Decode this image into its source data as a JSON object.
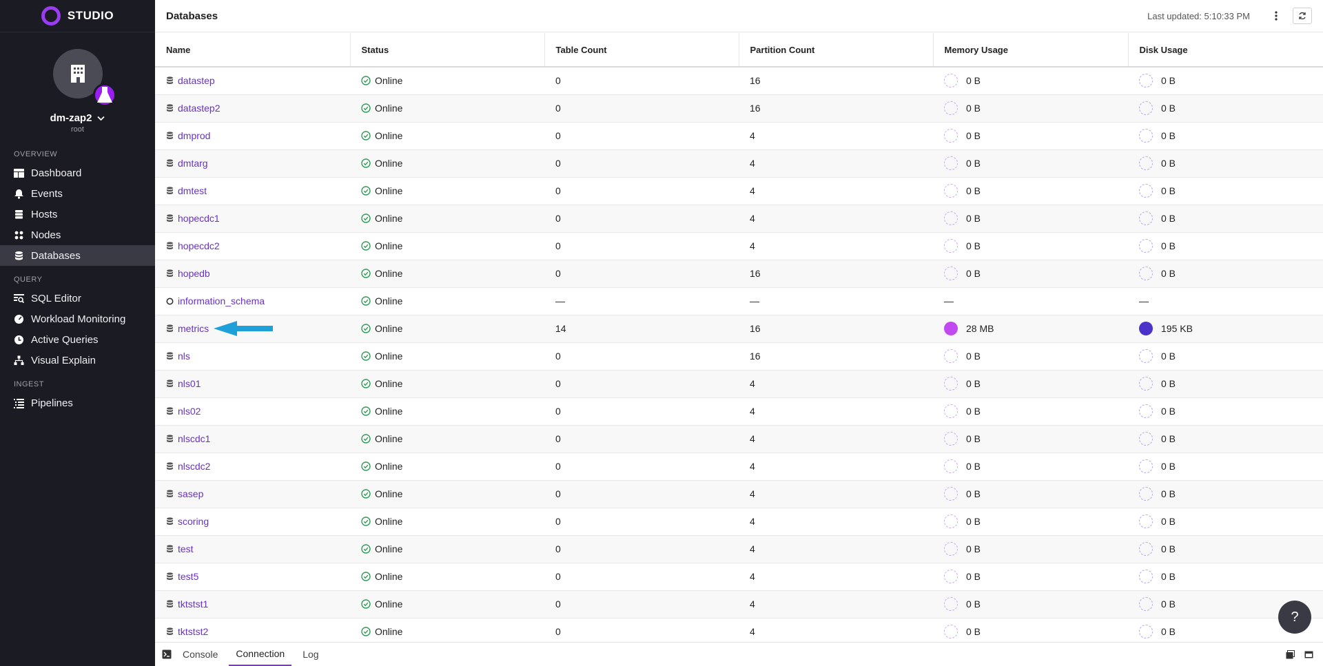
{
  "brand": {
    "name": "STUDIO"
  },
  "org": {
    "name": "dm-zap2",
    "role": "root"
  },
  "nav": {
    "overview_label": "OVERVIEW",
    "overview": [
      {
        "label": "Dashboard",
        "icon": "dashboard-icon"
      },
      {
        "label": "Events",
        "icon": "bell-icon"
      },
      {
        "label": "Hosts",
        "icon": "server-icon"
      },
      {
        "label": "Nodes",
        "icon": "nodes-icon"
      },
      {
        "label": "Databases",
        "icon": "database-icon",
        "active": true
      }
    ],
    "query_label": "QUERY",
    "query": [
      {
        "label": "SQL Editor",
        "icon": "sql-editor-icon"
      },
      {
        "label": "Workload Monitoring",
        "icon": "gauge-icon"
      },
      {
        "label": "Active Queries",
        "icon": "clock-icon"
      },
      {
        "label": "Visual Explain",
        "icon": "tree-icon"
      }
    ],
    "ingest_label": "INGEST",
    "ingest": [
      {
        "label": "Pipelines",
        "icon": "pipelines-icon"
      }
    ]
  },
  "header": {
    "title": "Databases",
    "last_updated": "Last updated: 5:10:33 PM"
  },
  "table": {
    "columns": [
      "Name",
      "Status",
      "Table Count",
      "Partition Count",
      "Memory Usage",
      "Disk Usage"
    ],
    "rows": [
      {
        "name": "datastep",
        "status": "Online",
        "tables": "0",
        "partitions": "16",
        "memory": "0 B",
        "disk": "0 B"
      },
      {
        "name": "datastep2",
        "status": "Online",
        "tables": "0",
        "partitions": "16",
        "memory": "0 B",
        "disk": "0 B"
      },
      {
        "name": "dmprod",
        "status": "Online",
        "tables": "0",
        "partitions": "4",
        "memory": "0 B",
        "disk": "0 B"
      },
      {
        "name": "dmtarg",
        "status": "Online",
        "tables": "0",
        "partitions": "4",
        "memory": "0 B",
        "disk": "0 B"
      },
      {
        "name": "dmtest",
        "status": "Online",
        "tables": "0",
        "partitions": "4",
        "memory": "0 B",
        "disk": "0 B"
      },
      {
        "name": "hopecdc1",
        "status": "Online",
        "tables": "0",
        "partitions": "4",
        "memory": "0 B",
        "disk": "0 B"
      },
      {
        "name": "hopecdc2",
        "status": "Online",
        "tables": "0",
        "partitions": "4",
        "memory": "0 B",
        "disk": "0 B"
      },
      {
        "name": "hopedb",
        "status": "Online",
        "tables": "0",
        "partitions": "16",
        "memory": "0 B",
        "disk": "0 B"
      },
      {
        "name": "information_schema",
        "status": "Online",
        "tables": "—",
        "partitions": "—",
        "memory": "—",
        "disk": "—",
        "system": true
      },
      {
        "name": "metrics",
        "status": "Online",
        "tables": "14",
        "partitions": "16",
        "memory": "28 MB",
        "disk": "195 KB",
        "highlight": true
      },
      {
        "name": "nls",
        "status": "Online",
        "tables": "0",
        "partitions": "16",
        "memory": "0 B",
        "disk": "0 B"
      },
      {
        "name": "nls01",
        "status": "Online",
        "tables": "0",
        "partitions": "4",
        "memory": "0 B",
        "disk": "0 B"
      },
      {
        "name": "nls02",
        "status": "Online",
        "tables": "0",
        "partitions": "4",
        "memory": "0 B",
        "disk": "0 B"
      },
      {
        "name": "nlscdc1",
        "status": "Online",
        "tables": "0",
        "partitions": "4",
        "memory": "0 B",
        "disk": "0 B"
      },
      {
        "name": "nlscdc2",
        "status": "Online",
        "tables": "0",
        "partitions": "4",
        "memory": "0 B",
        "disk": "0 B"
      },
      {
        "name": "sasep",
        "status": "Online",
        "tables": "0",
        "partitions": "4",
        "memory": "0 B",
        "disk": "0 B"
      },
      {
        "name": "scoring",
        "status": "Online",
        "tables": "0",
        "partitions": "4",
        "memory": "0 B",
        "disk": "0 B"
      },
      {
        "name": "test",
        "status": "Online",
        "tables": "0",
        "partitions": "4",
        "memory": "0 B",
        "disk": "0 B"
      },
      {
        "name": "test5",
        "status": "Online",
        "tables": "0",
        "partitions": "4",
        "memory": "0 B",
        "disk": "0 B"
      },
      {
        "name": "tktstst1",
        "status": "Online",
        "tables": "0",
        "partitions": "4",
        "memory": "0 B",
        "disk": "0 B"
      },
      {
        "name": "tktstst2",
        "status": "Online",
        "tables": "0",
        "partitions": "4",
        "memory": "0 B",
        "disk": "0 B"
      }
    ]
  },
  "bottom_tabs": [
    {
      "label": "Console"
    },
    {
      "label": "Connection",
      "active": true
    },
    {
      "label": "Log"
    }
  ],
  "help_label": "?",
  "colors": {
    "accent": "#8a2be2",
    "link": "#6a2fd0",
    "online": "#2e9c57",
    "memory_fill": "#c04af0",
    "disk_fill": "#4a33c8",
    "arrow": "#1fa0d8"
  }
}
